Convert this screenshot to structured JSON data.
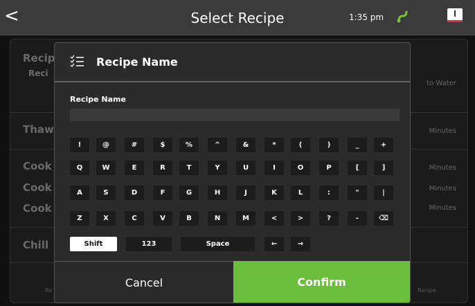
{
  "header": {
    "title": "Select Recipe",
    "time": "1:35 pm",
    "back_glyph": "<"
  },
  "background": {
    "rows": [
      {
        "label": "Recip",
        "sub": "Reci",
        "right": "to Water"
      },
      {
        "label": "Thaw",
        "right": "Minutes"
      },
      {
        "label": "Cook",
        "right": "Minutes"
      },
      {
        "label": "Cook",
        "right": "Minutes"
      },
      {
        "label": "Cook",
        "right": "Minutes"
      },
      {
        "label": "Chill",
        "right": ""
      }
    ],
    "footer_left": "Re",
    "footer_right": "Recipe"
  },
  "modal": {
    "title": "Recipe Name",
    "field_label": "Recipe Name",
    "field_value": "",
    "keys": {
      "row1": [
        "!",
        "@",
        "#",
        "$",
        "%",
        "^",
        "&",
        "*",
        "(",
        ")",
        "_",
        "+"
      ],
      "row2": [
        "Q",
        "W",
        "E",
        "R",
        "T",
        "Y",
        "U",
        "I",
        "O",
        "P",
        "[",
        "]"
      ],
      "row3": [
        "A",
        "S",
        "D",
        "F",
        "G",
        "H",
        "J",
        "K",
        "L",
        ":",
        "\"",
        "|"
      ],
      "row4": [
        "Z",
        "X",
        "C",
        "V",
        "B",
        "N",
        "M",
        "<",
        ">",
        "?",
        "-",
        "⌫"
      ],
      "row5": [
        "Shift",
        "123",
        "Space",
        "←",
        "→"
      ]
    },
    "cancel_label": "Cancel",
    "confirm_label": "Confirm"
  },
  "colors": {
    "confirm": "#6bbd3c",
    "plug": "#79c22f",
    "topbar": "#3b3b3b"
  }
}
